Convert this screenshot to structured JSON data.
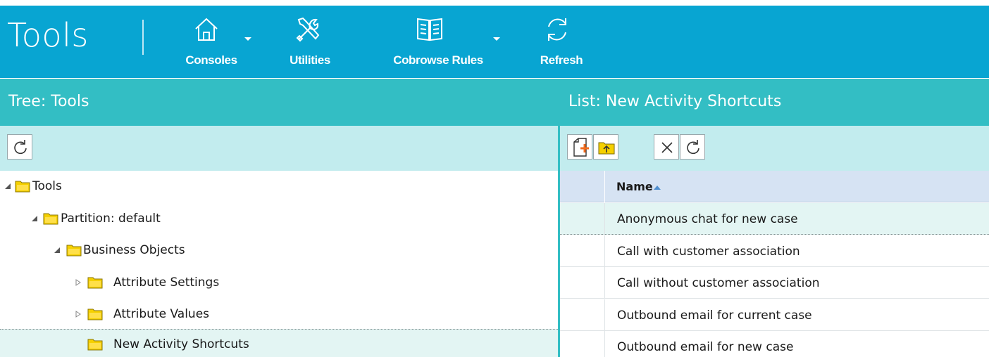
{
  "app": {
    "title": "Tools"
  },
  "ribbon": {
    "buttons": [
      {
        "label": "Consoles",
        "icon": "home-icon",
        "has_dropdown": true
      },
      {
        "label": "Utilities",
        "icon": "tools-icon",
        "has_dropdown": false
      },
      {
        "label": "Cobrowse Rules",
        "icon": "book-icon",
        "has_dropdown": true
      },
      {
        "label": "Refresh",
        "icon": "refresh-icon",
        "has_dropdown": false
      }
    ]
  },
  "tree_panel": {
    "title": "Tree: Tools",
    "toolbar": [
      {
        "icon": "refresh-icon"
      }
    ],
    "nodes": [
      {
        "label": "Tools",
        "expanded": true,
        "level": 0
      },
      {
        "label": "Partition: default",
        "expanded": true,
        "level": 1
      },
      {
        "label": "Business Objects",
        "expanded": true,
        "level": 2
      },
      {
        "label": "Attribute Settings",
        "expanded": false,
        "level": 3
      },
      {
        "label": "Attribute Values",
        "expanded": false,
        "level": 3
      },
      {
        "label": "New Activity Shortcuts",
        "expanded": null,
        "level": 3,
        "selected": true
      }
    ]
  },
  "list_panel": {
    "title": "List: New Activity Shortcuts",
    "toolbar": [
      {
        "icon": "new-item-icon"
      },
      {
        "icon": "new-folder-icon"
      },
      {
        "icon": "delete-icon"
      },
      {
        "icon": "refresh-icon"
      }
    ],
    "columns": [
      {
        "label": "Name",
        "sort": "ascending"
      }
    ],
    "rows": [
      "Anonymous chat for new case",
      "Call with customer association",
      "Call without customer association",
      "Outbound email for current case",
      "Outbound email for new case"
    ]
  },
  "colors": {
    "ribbon": "#08a5d2",
    "panel_header": "#33bec4",
    "toolbar": "#c2ecee",
    "selection": "#e3f5f3",
    "folder": "#f5d000"
  }
}
